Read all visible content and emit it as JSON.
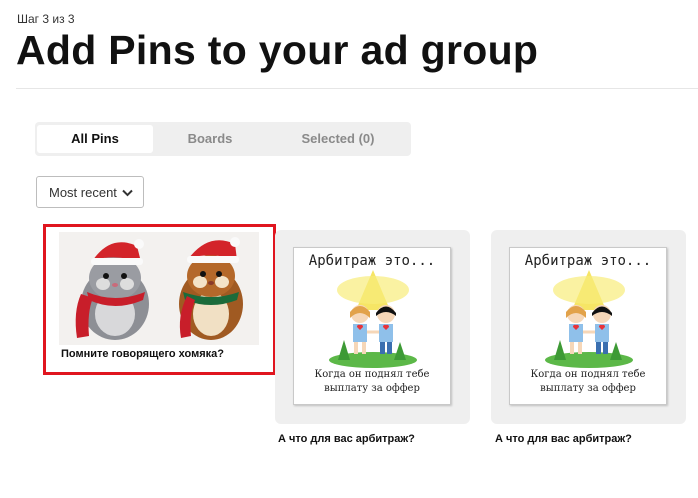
{
  "header": {
    "step": "Шаг 3 из 3",
    "title": "Add Pins to your ad group"
  },
  "tabs": [
    {
      "label": "All Pins",
      "active": true
    },
    {
      "label": "Boards",
      "active": false
    },
    {
      "label": "Selected (0)",
      "active": false
    }
  ],
  "sort": {
    "selected": "Most recent",
    "icon": "chevron-down-icon"
  },
  "pins": [
    {
      "caption": "Помните говорящего хомяка?",
      "selected": true,
      "highlight_color": "#e0151f"
    },
    {
      "caption": "А что для вас арбитраж?",
      "image_title": "Арбитраж это...",
      "image_caption_line1": "Когда он поднял тебе",
      "image_caption_line2": "выплату за оффер"
    },
    {
      "caption": "А что для вас арбитраж?",
      "image_title": "Арбитраж это...",
      "image_caption_line1": "Когда он поднял тебе",
      "image_caption_line2": "выплату за оффер"
    }
  ]
}
